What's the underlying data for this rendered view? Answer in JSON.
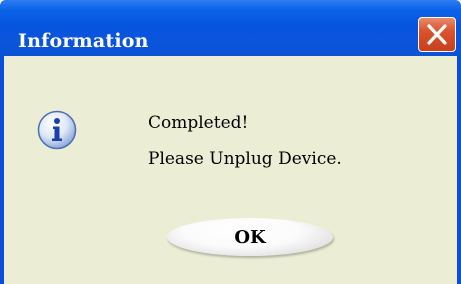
{
  "window": {
    "title": "Information"
  },
  "dialog": {
    "icon": "info-icon",
    "message_line1": "Completed!",
    "message_line2": "Please Unplug Device.",
    "ok_label": "OK"
  },
  "colors": {
    "titlebar": "#0754df",
    "client_background": "#ecedd5",
    "close_button": "#d9532c"
  }
}
